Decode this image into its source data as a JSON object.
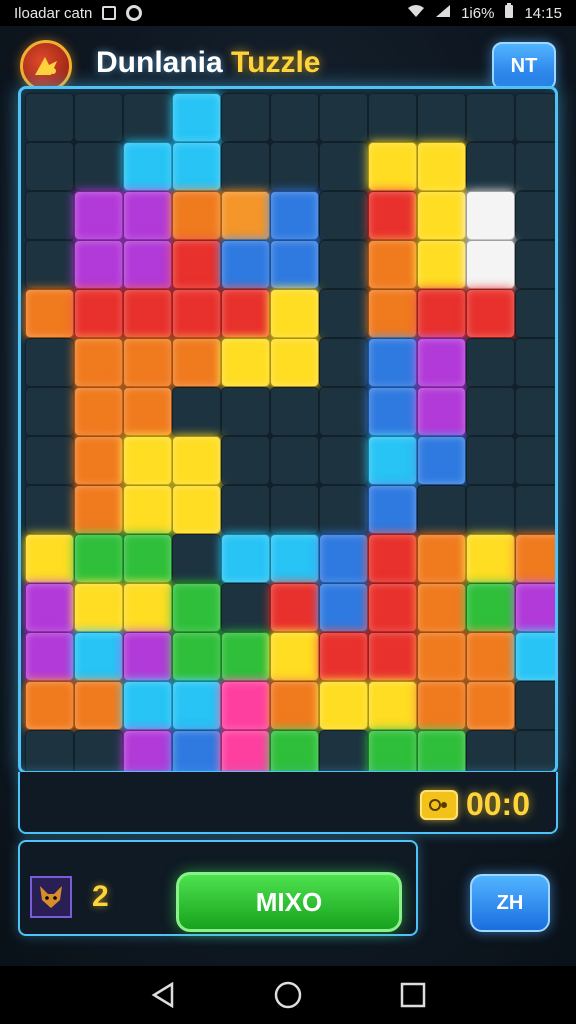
{
  "status_bar": {
    "left_text": "Iloadar catn",
    "right_text": "1i6%",
    "time": "14:15"
  },
  "header": {
    "title_part1": "Dunlania",
    "title_part2": "Tuzzle",
    "right_button_label": "NT"
  },
  "game": {
    "timer": "00:0",
    "pieces_count": "2",
    "mix_button_label": "MIXO",
    "side_button_label": "ZH"
  },
  "colors": {
    "accent": "#4fc3f7",
    "gold": "#ffd43a",
    "green": "#2ecc40",
    "empty": "#1d3340"
  },
  "board": {
    "rows": 14,
    "cols": 11,
    "grid": [
      "...c.......",
      "..cc...yy..",
      ".ppoOb.ryw.",
      ".pprbb.oyw.",
      "orrrry.orr.",
      ".oooyy.bp..",
      ".oo....bp..",
      ".oyy...cb..",
      ".oyy...b...",
      "ygg.ccbroyo",
      "pyyg.rbrogp",
      "pcpggyrrooc",
      "ooccmoyyoo.",
      "..pbmg.gg.."
    ]
  }
}
